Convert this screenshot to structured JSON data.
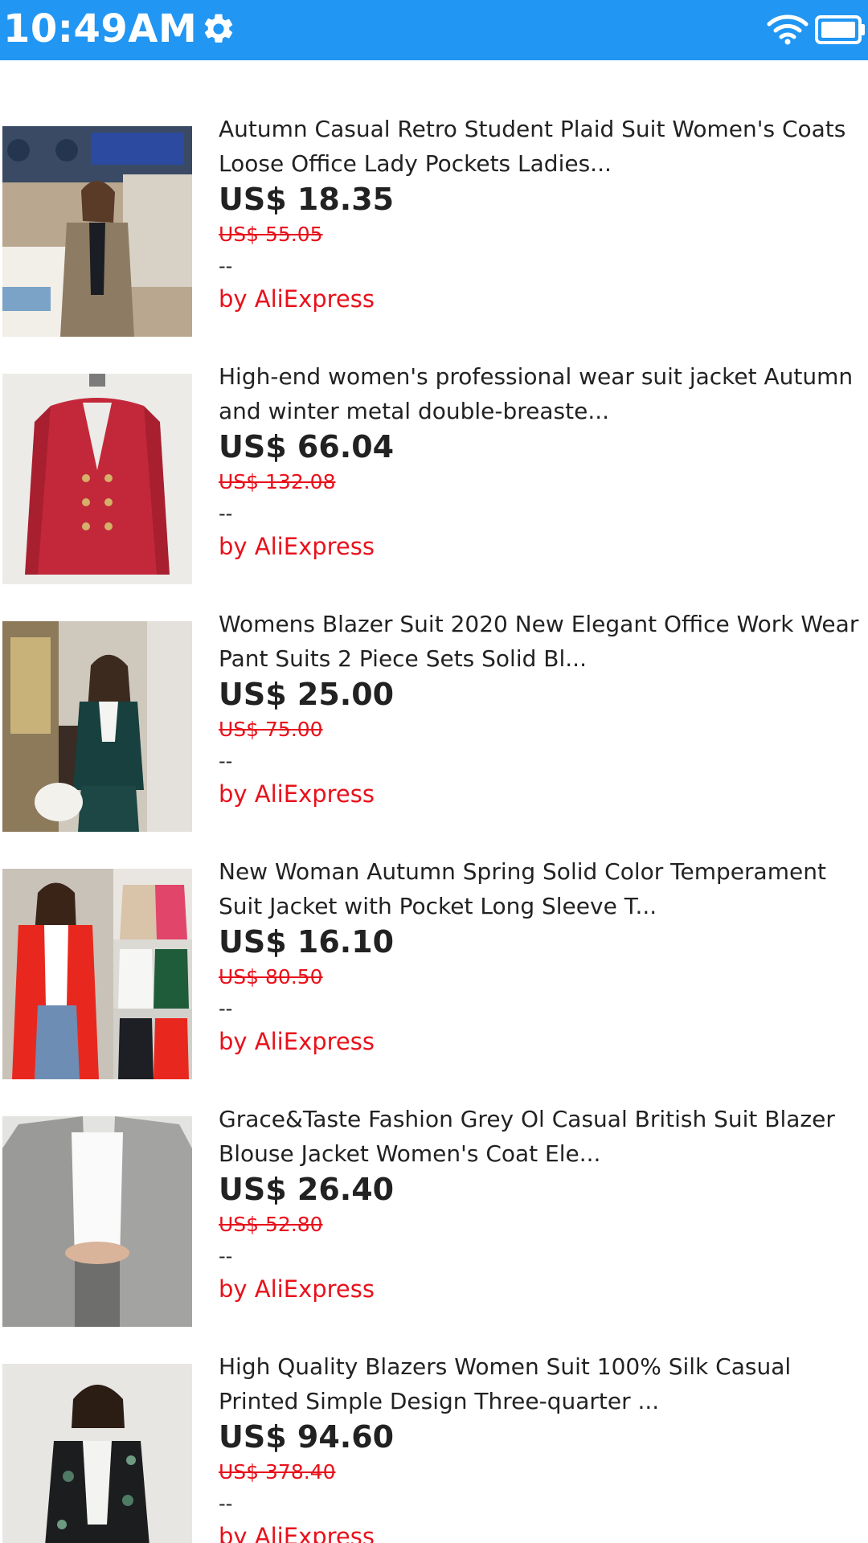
{
  "status_bar": {
    "time": "10:49AM",
    "settings_icon": "gear-icon",
    "wifi_icon": "wifi-icon",
    "battery_icon": "battery-icon",
    "background": "#2196f3"
  },
  "products": [
    {
      "title": "Autumn Casual Retro Student Plaid Suit Women's Coats Loose Office Lady Pockets Ladies...",
      "price": "US$ 18.35",
      "original_price": "US$ 55.05",
      "rating": "--",
      "seller": "by AliExpress"
    },
    {
      "title": "High-end women's professional wear suit jacket Autumn and winter metal double-breaste...",
      "price": "US$ 66.04",
      "original_price": "US$ 132.08",
      "rating": "--",
      "seller": "by AliExpress"
    },
    {
      "title": "Womens Blazer Suit 2020 New Elegant Office Work Wear Pant Suits 2 Piece Sets Solid Bl...",
      "price": "US$ 25.00",
      "original_price": "US$ 75.00",
      "rating": "--",
      "seller": "by AliExpress"
    },
    {
      "title": "New Woman Autumn Spring Solid Color Temperament Suit Jacket with Pocket Long Sleeve T...",
      "price": "US$ 16.10",
      "original_price": "US$ 80.50",
      "rating": "--",
      "seller": "by AliExpress"
    },
    {
      "title": "Grace&Taste Fashion Grey Ol Casual British Suit Blazer Blouse Jacket Women's Coat Ele...",
      "price": "US$ 26.40",
      "original_price": "US$ 52.80",
      "rating": "--",
      "seller": "by AliExpress"
    },
    {
      "title": "High Quality Blazers Women Suit 100% Silk Casual Printed Simple Design Three-quarter ...",
      "price": "US$ 94.60",
      "original_price": "US$ 378.40",
      "rating": "--",
      "seller": "by AliExpress"
    }
  ]
}
